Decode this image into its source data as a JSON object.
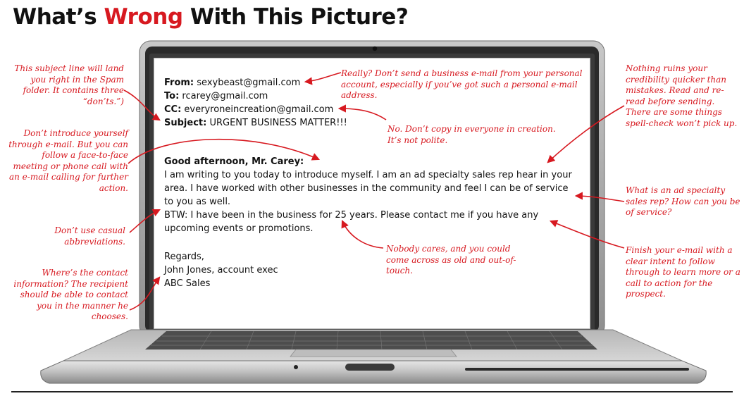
{
  "title": {
    "part1": "What’s ",
    "accent": "Wrong",
    "part2": " With This Picture?"
  },
  "colors": {
    "accent": "#d71920",
    "text": "#111111",
    "laptop_frame": "#9a9a9a"
  },
  "email": {
    "from_label": "From:",
    "from_value": "sexybeast@gmail.com",
    "to_label": "To:",
    "to_value": "rcarey@gmail.com",
    "cc_label": "CC:",
    "cc_value": "everyroneincreation@gmail.com",
    "subject_label": "Subject:",
    "subject_value": "URGENT BUSINESS MATTER!!!",
    "greeting": "Good afternoon, Mr. Carey:",
    "body1": "I am writing to you today to introduce myself. I am an ad specialty sales rep hear in your area. I have worked with other businesses in the community and feel I can be of service to you as well.",
    "body2": "BTW: I have been in the business for 25 years. Please contact me if you have any upcoming events or promotions.",
    "closing": "Regards,",
    "sig_name": "John Jones, account exec",
    "sig_company": "ABC Sales"
  },
  "annotations": {
    "subject": "This subject line will land you right in the Spam folder. It contains three “don’ts.”)",
    "introduce": "Don’t introduce yourself through e-mail. But you can follow a face-to-face meeting or phone call with an e-mail calling for further action.",
    "abbrev": "Don’t use casual abbreviations.",
    "contact": "Where’s the contact information? The recipient should be able to contact you in the manner he chooses.",
    "personal": "Really? Don’t send a business e-mail from your personal account, especially if you’ve got such a personal e-mail address.",
    "copy": "No. Don’t copy in everyone in creation. It’s not polite.",
    "nobody": "Nobody cares, and you could come across as old and out-of-touch.",
    "mistakes": "Nothing ruins your credibility quicker than mistakes. Read and re-read before sending. There are some things spell-check won’t pick up.",
    "specialty": "What is an ad specialty sales rep? How can you be of service?",
    "finish": "Finish your e-mail with a clear intent to follow through to learn more or a call to action for the prospect."
  }
}
